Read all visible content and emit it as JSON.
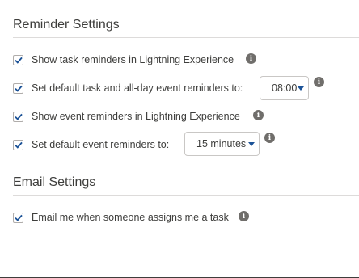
{
  "reminder_settings": {
    "title": "Reminder Settings",
    "items": [
      {
        "label": "Show task reminders in Lightning Experience",
        "checked": true
      },
      {
        "label": "Set default task and all-day event reminders to:",
        "checked": true,
        "select_value": "08:00"
      },
      {
        "label": "Show event reminders in Lightning Experience",
        "checked": true
      },
      {
        "label": "Set default event reminders to:",
        "checked": true,
        "select_value": "15 minutes"
      }
    ]
  },
  "email_settings": {
    "title": "Email Settings",
    "items": [
      {
        "label": "Email me when someone assigns me a task",
        "checked": true
      }
    ]
  },
  "icons": {
    "checkbox_check": "checkmark-icon",
    "info": "info-icon",
    "dropdown": "caret-down-icon"
  },
  "colors": {
    "text": "#3e3e3c",
    "divider": "#dddbda",
    "check": "#1b5297",
    "caret": "#1b5297",
    "info_icon": "#706e6b"
  }
}
